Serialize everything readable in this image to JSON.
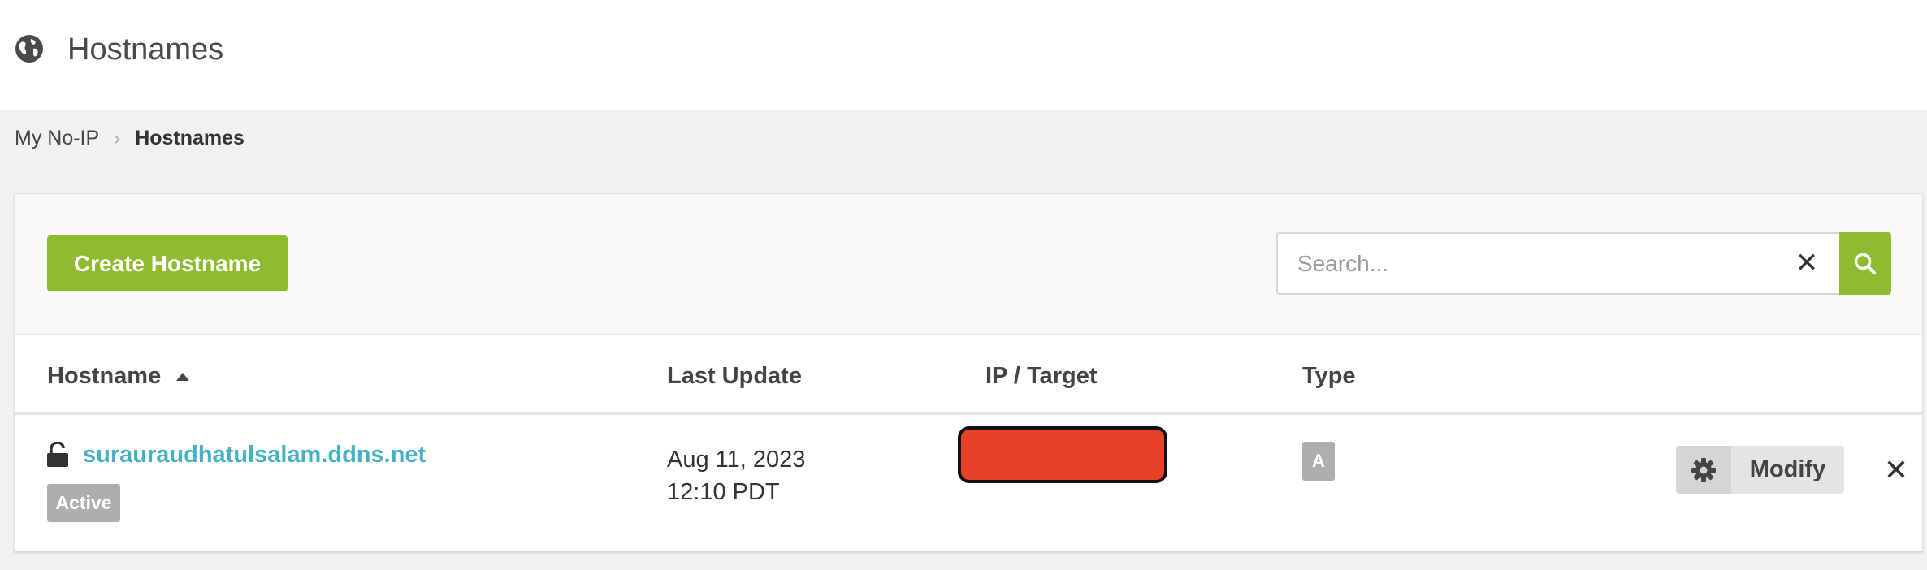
{
  "header": {
    "title": "Hostnames",
    "icon": "globe-icon"
  },
  "breadcrumb": {
    "items": [
      "My No-IP",
      "Hostnames"
    ],
    "separator": "›"
  },
  "toolbar": {
    "create_label": "Create Hostname",
    "search_placeholder": "Search...",
    "search_value": "",
    "clear_glyph": "✕"
  },
  "table": {
    "columns": [
      "Hostname",
      "Last Update",
      "IP / Target",
      "Type"
    ],
    "sort": {
      "column": "Hostname",
      "direction": "asc"
    },
    "rows": [
      {
        "hostname": "surauraudhatulsalam.ddns.net",
        "status": "Active",
        "last_update_date": "Aug 11, 2023",
        "last_update_time": "12:10 PDT",
        "ip_target": "",
        "type": "A",
        "modify_label": "Modify",
        "delete_glyph": "✕"
      }
    ]
  },
  "colors": {
    "accent_green": "#8fbc2f",
    "link_teal": "#45b1c4",
    "badge_gray": "#aeaeae",
    "redaction_red": "#e8412a"
  }
}
